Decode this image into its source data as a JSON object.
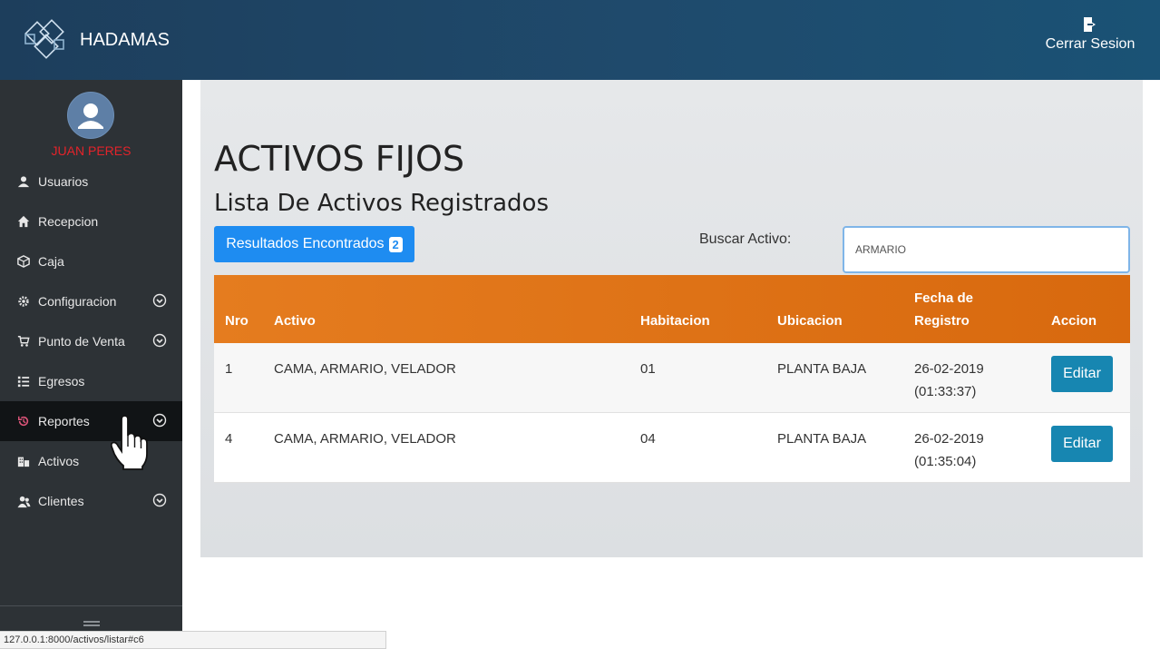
{
  "header": {
    "brand": "HADAMAS",
    "logout_label": "Cerrar Sesion"
  },
  "sidebar": {
    "username": "JUAN PERES",
    "items": [
      {
        "label": "Usuarios",
        "icon": "user-icon",
        "has_submenu": false
      },
      {
        "label": "Recepcion",
        "icon": "home-icon",
        "has_submenu": false
      },
      {
        "label": "Caja",
        "icon": "box-icon",
        "has_submenu": false
      },
      {
        "label": "Configuracion",
        "icon": "gear-icon",
        "has_submenu": true
      },
      {
        "label": "Punto de Venta",
        "icon": "cart-icon",
        "has_submenu": true
      },
      {
        "label": "Egresos",
        "icon": "list-icon",
        "has_submenu": false
      },
      {
        "label": "Reportes",
        "icon": "history-icon",
        "has_submenu": true,
        "active": true
      },
      {
        "label": "Activos",
        "icon": "building-icon",
        "has_submenu": false
      },
      {
        "label": "Clientes",
        "icon": "users-icon",
        "has_submenu": true
      }
    ]
  },
  "main": {
    "title": "ACTIVOS FIJOS",
    "subtitle": "Lista De Activos Registrados",
    "results_label": "Resultados Encontrados",
    "results_count": "2",
    "search_label": "Buscar Activo:",
    "search_value": "ARMARIO"
  },
  "table": {
    "headers": {
      "nro": "Nro",
      "activo": "Activo",
      "habitacion": "Habitacion",
      "ubicacion": "Ubicacion",
      "fecha_line1": "Fecha de",
      "fecha_line2": "Registro",
      "accion": "Accion"
    },
    "rows": [
      {
        "nro": "1",
        "activo": "CAMA, ARMARIO, VELADOR",
        "habitacion": "01",
        "ubicacion": "PLANTA BAJA",
        "fecha": "26-02-2019",
        "hora": "(01:33:37)",
        "action": "Editar"
      },
      {
        "nro": "4",
        "activo": "CAMA, ARMARIO, VELADOR",
        "habitacion": "04",
        "ubicacion": "PLANTA BAJA",
        "fecha": "26-02-2019",
        "hora": "(01:35:04)",
        "action": "Editar"
      }
    ]
  },
  "statusbar": {
    "url": "127.0.0.1:8000/activos/listar#c6"
  },
  "colors": {
    "header_bg": "#1f4a6c",
    "sidebar_bg": "#2d3236",
    "table_header": "#e57c1f",
    "primary_button": "#1e8cf1",
    "edit_button": "#1786b1",
    "username": "#e4232a"
  }
}
